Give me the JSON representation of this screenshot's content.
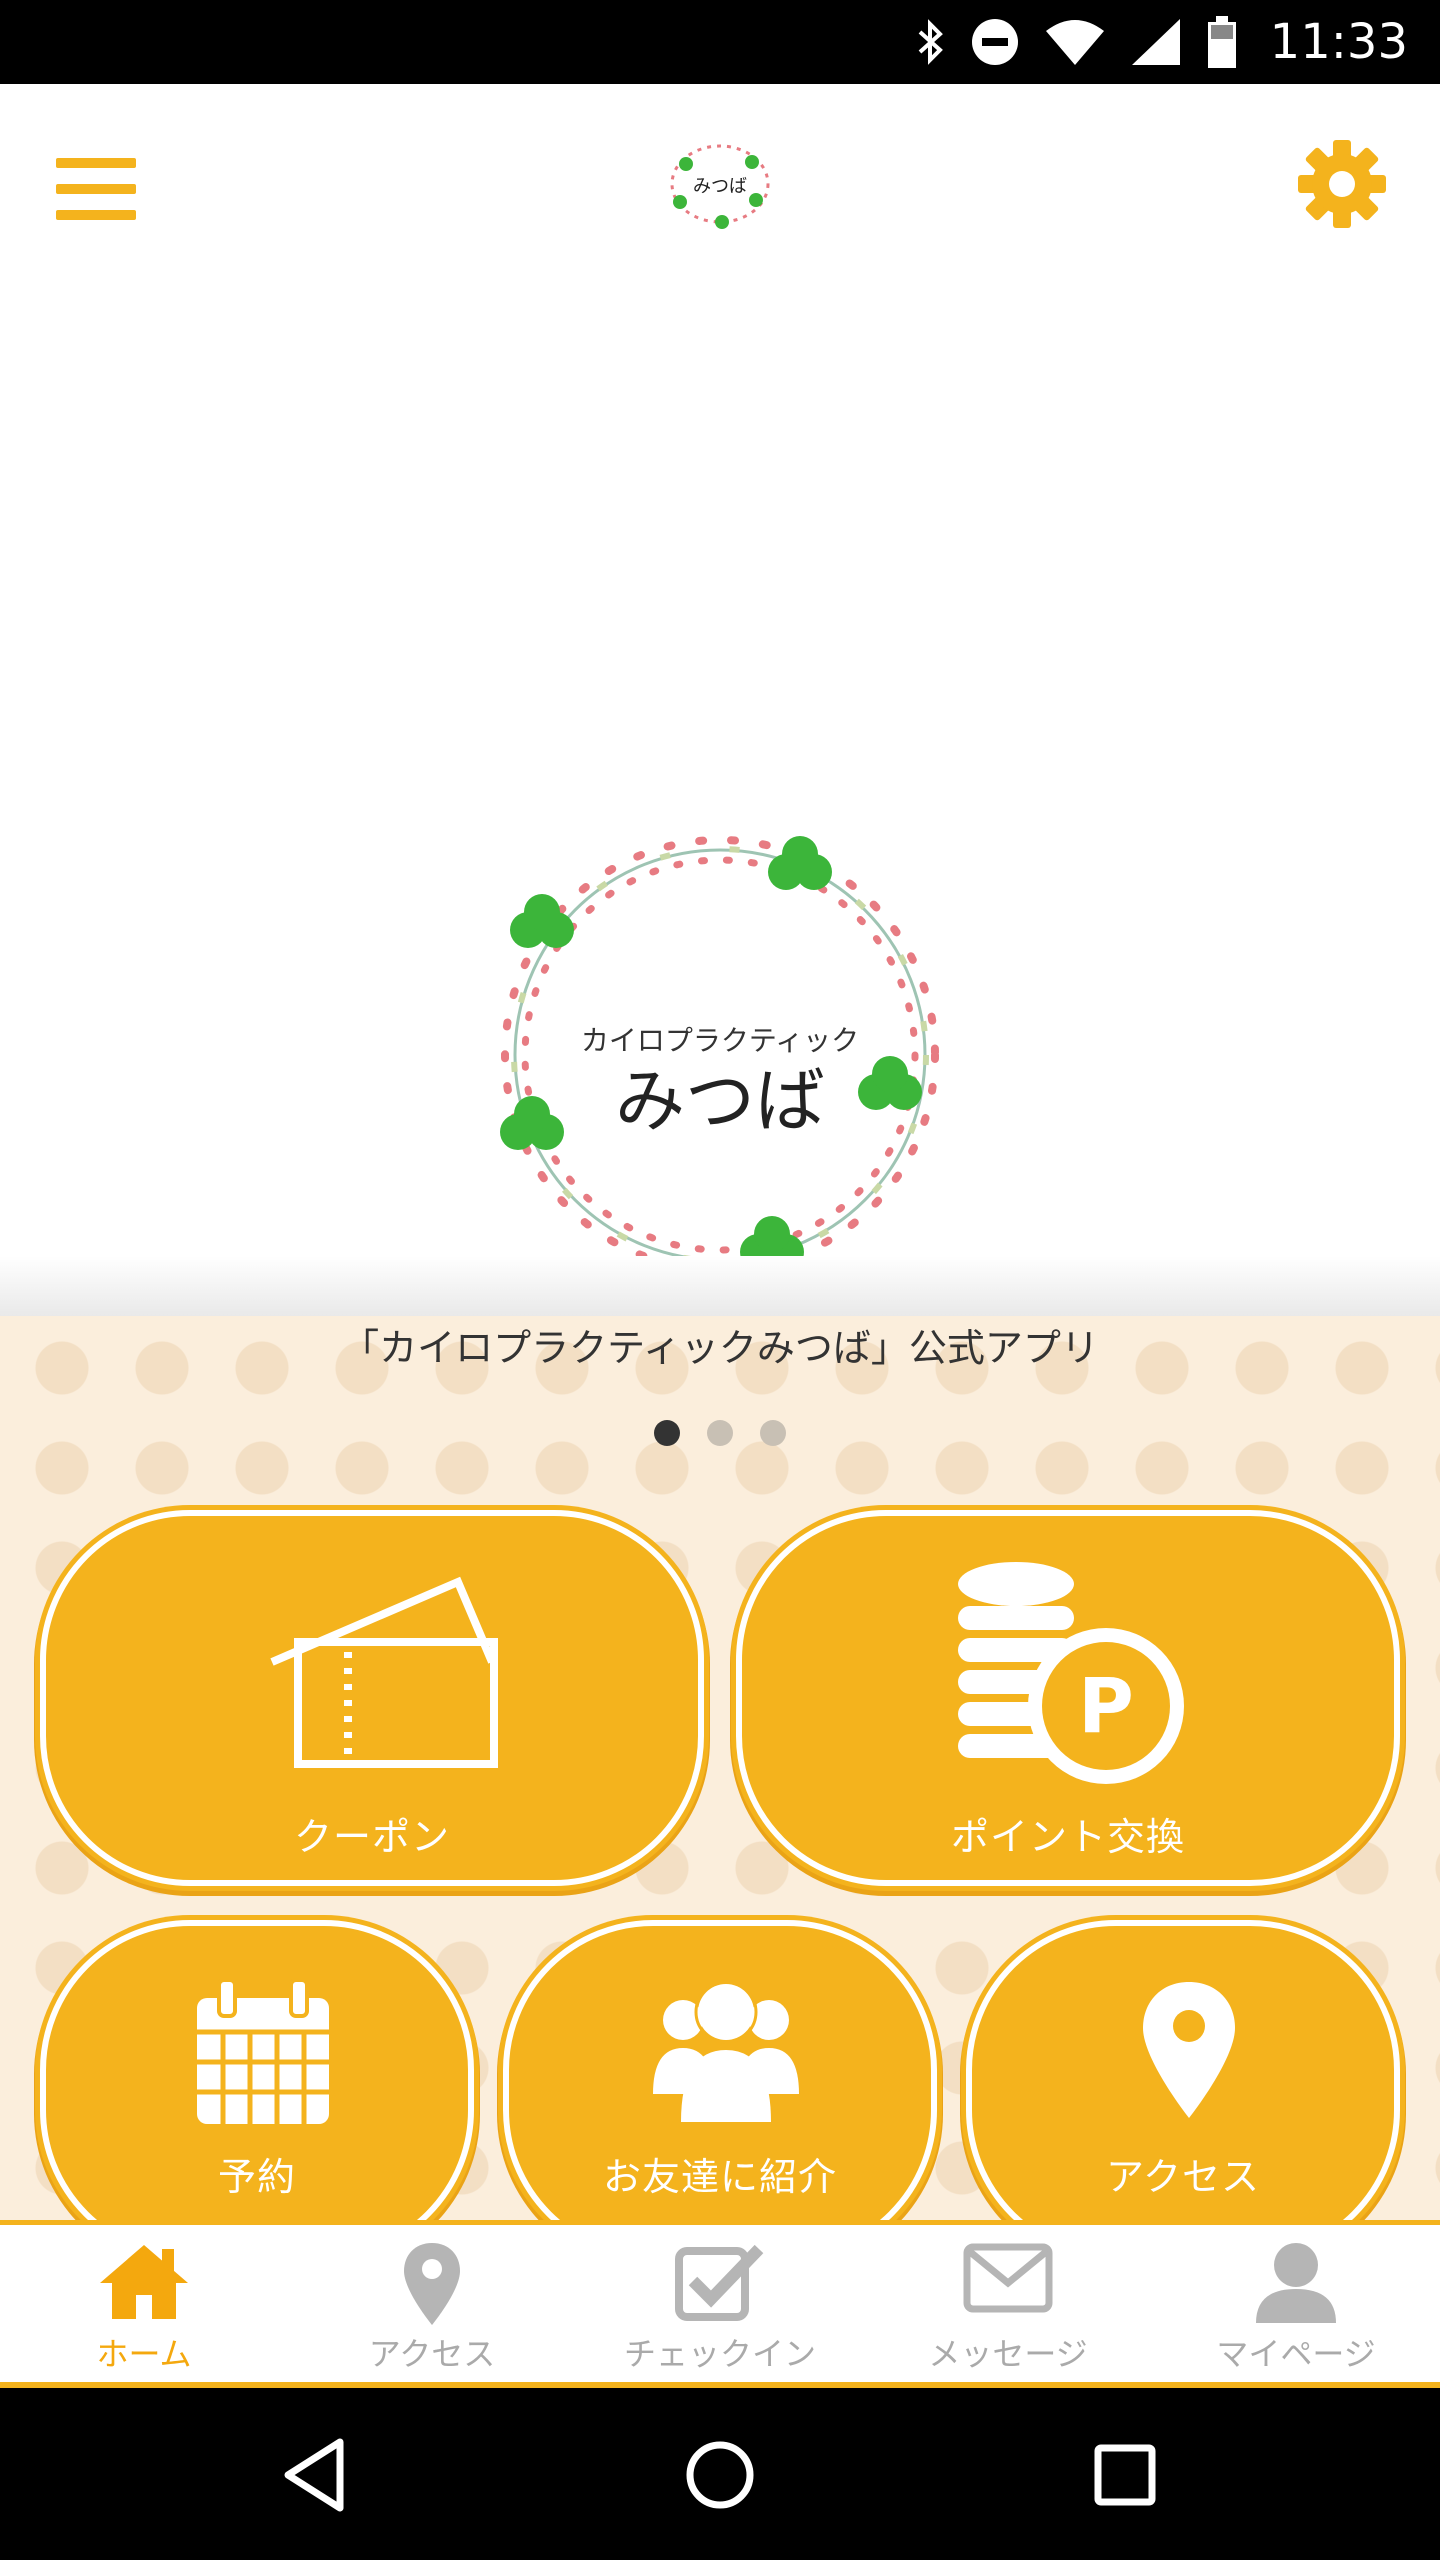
{
  "status_bar": {
    "time": "11:33",
    "icons": [
      "bluetooth-icon",
      "do-not-disturb-icon",
      "wifi-icon",
      "signal-icon",
      "battery-icon"
    ]
  },
  "header": {
    "menu_icon": "hamburger-menu-icon",
    "settings_icon": "gear-icon",
    "logo_text": "みつば"
  },
  "hero": {
    "logo_subtitle": "カイロプラクティック",
    "logo_title": "みつば"
  },
  "slider": {
    "caption": "「カイロプラクティックみつば」公式アプリ",
    "page_count": 3,
    "active_index": 0
  },
  "tiles": [
    {
      "label": "クーポン",
      "icon": "ticket-icon"
    },
    {
      "label": "ポイント交換",
      "icon": "coins-point-icon"
    },
    {
      "label": "予約",
      "icon": "calendar-icon"
    },
    {
      "label": "お友達に紹介",
      "icon": "group-icon"
    },
    {
      "label": "アクセス",
      "icon": "map-pin-icon"
    }
  ],
  "bottom_nav": [
    {
      "label": "ホーム",
      "icon": "home-icon",
      "active": true
    },
    {
      "label": "アクセス",
      "icon": "map-pin-icon",
      "active": false
    },
    {
      "label": "チェックイン",
      "icon": "checkbox-icon",
      "active": false
    },
    {
      "label": "メッセージ",
      "icon": "envelope-icon",
      "active": false
    },
    {
      "label": "マイページ",
      "icon": "person-icon",
      "active": false
    }
  ],
  "colors": {
    "accent": "#f4b31d",
    "active_nav": "#f4a80e",
    "inactive_nav": "#aaaaaa",
    "background_pattern": "#fbeedc"
  }
}
